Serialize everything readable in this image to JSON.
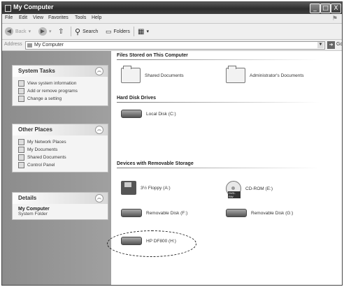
{
  "window": {
    "title": "My Computer"
  },
  "title_buttons": [
    "_",
    "□",
    "X"
  ],
  "menu": [
    "File",
    "Edit",
    "View",
    "Favorites",
    "Tools",
    "Help"
  ],
  "toolbar": {
    "back": "Back",
    "search": "Search",
    "folders": "Folders"
  },
  "address": {
    "label": "Address",
    "value": "My Computer",
    "go": "Go"
  },
  "system_tasks": {
    "title": "System Tasks",
    "items": [
      "View system information",
      "Add or remove programs",
      "Change a setting"
    ]
  },
  "other_places": {
    "title": "Other Places",
    "items": [
      "My Network Places",
      "My Documents",
      "Shared Documents",
      "Control Panel"
    ]
  },
  "details": {
    "title": "Details",
    "name": "My Computer",
    "type": "System Folder"
  },
  "groups": {
    "files": {
      "title": "Files Stored on This Computer",
      "items": [
        "Shared Documents",
        "Administrator's Documents"
      ]
    },
    "hdd": {
      "title": "Hard Disk Drives",
      "items": [
        "Local Disk (C:)"
      ]
    },
    "removable": {
      "title": "Devices with Removable Storage",
      "items": [
        "3½ Floppy (A:)",
        "CD-ROM (E:)",
        "Removable Disk (F:)",
        "Removable Disk (G:)",
        "HP DF800 (H:)"
      ],
      "cd_badge": "DVD-RW"
    }
  }
}
